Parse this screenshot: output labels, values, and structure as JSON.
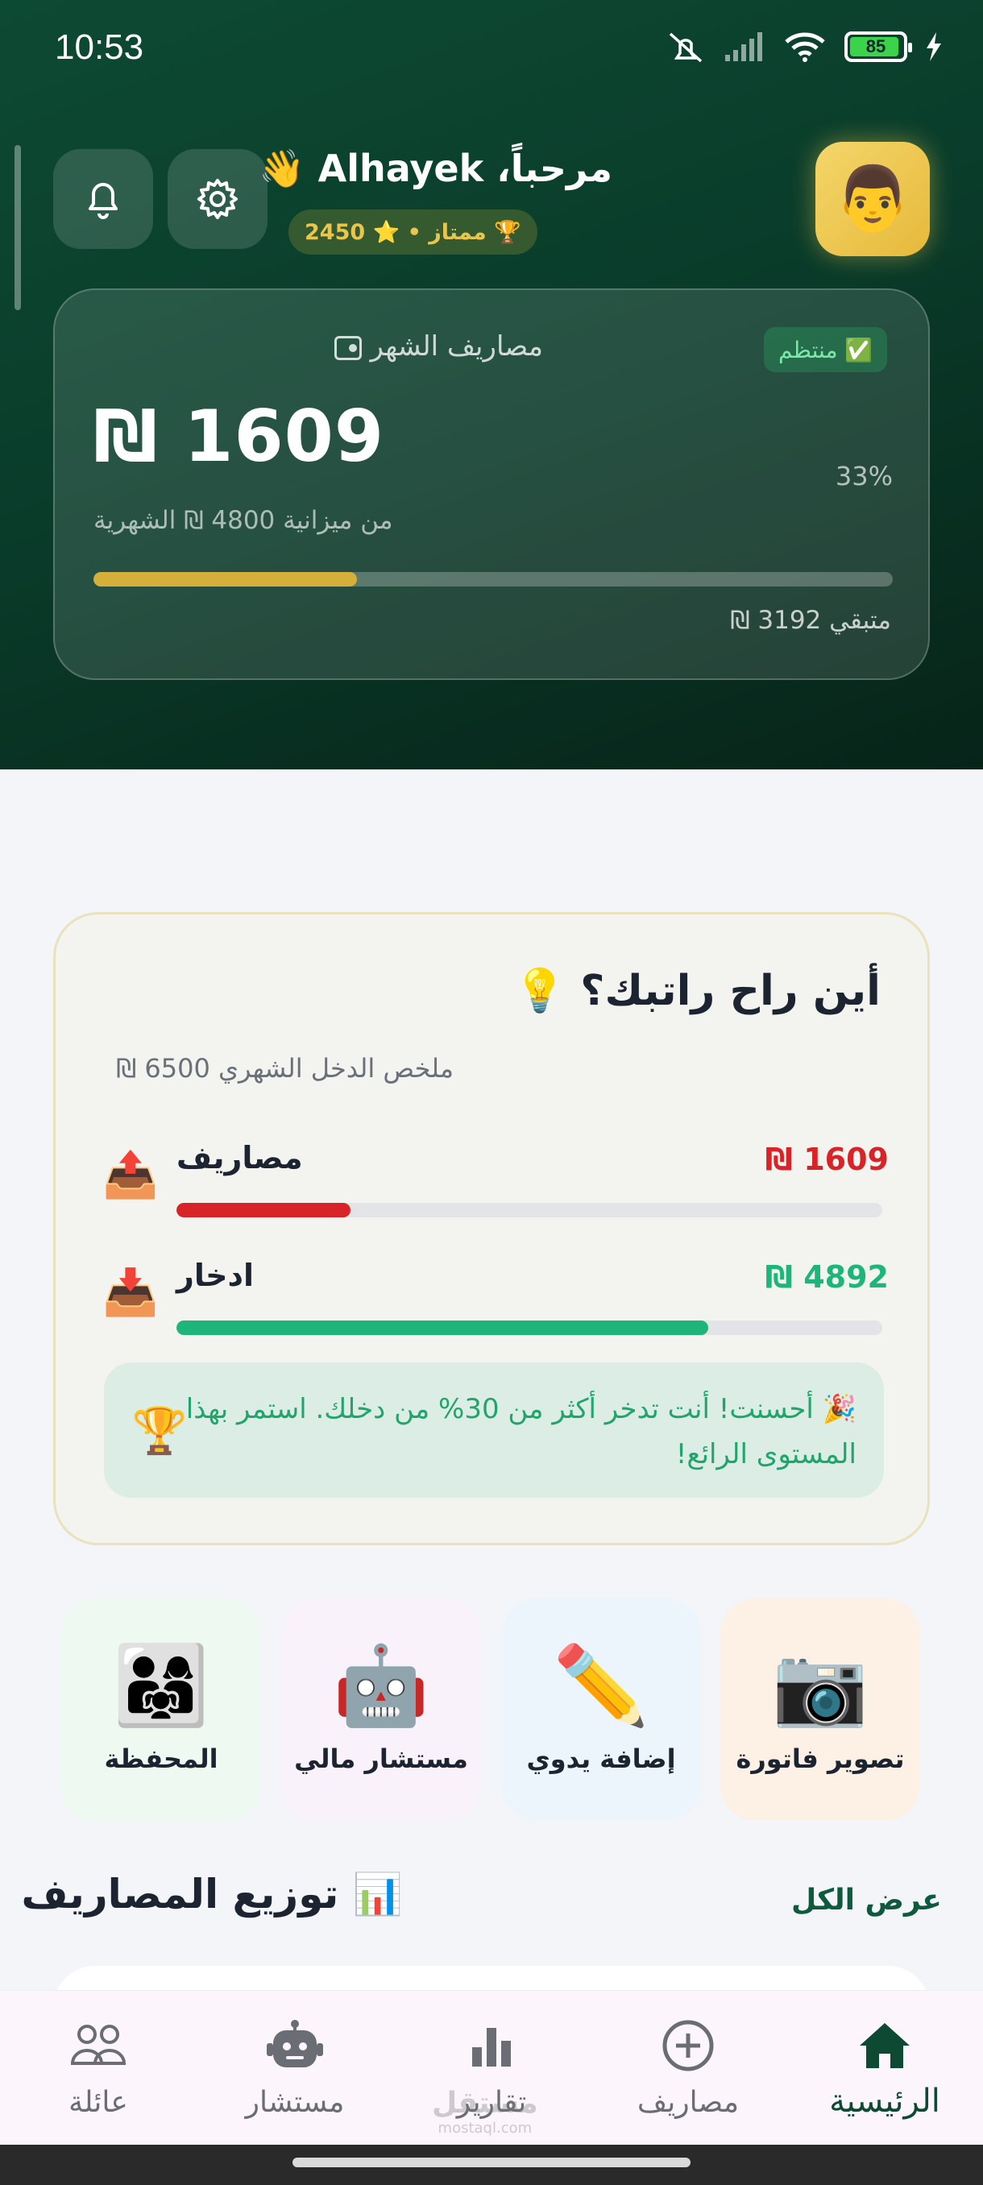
{
  "status": {
    "time": "10:53",
    "battery": "85"
  },
  "header": {
    "greeting": "مرحباً، Alhayek 👋",
    "rank": "🏆 ممتاز • ⭐ 2450",
    "avatar_emoji": "👨"
  },
  "month_card": {
    "title": "مصاريف الشهر",
    "badge": "✅ منتظم",
    "amount": "₪ 1609",
    "budget_text": "من ميزانية 4800 ₪ الشهرية",
    "percent": "33%",
    "progress_fraction": 0.33,
    "remaining": "متبقي 3192 ₪"
  },
  "salary_card": {
    "title": "أين راح راتبك؟ 💡",
    "subtitle": "ملخص الدخل الشهري 6500 ₪",
    "rows": [
      {
        "label": "مصاريف",
        "amount": "₪ 1609",
        "icon": "📤",
        "fraction": 0.247,
        "color": "#d82428"
      },
      {
        "label": "ادخار",
        "amount": "₪ 4892",
        "icon": "📥",
        "fraction": 0.753,
        "color": "#1db57a"
      }
    ],
    "tip": "🎉 أحسنت! أنت تدخر أكثر من 30% من دخلك. استمر بهذا المستوى الرائع!",
    "tip_icon": "🏆"
  },
  "actions": [
    {
      "label": "المحفظة",
      "emoji": "👨‍👩‍👧",
      "bg": "#eefaf1"
    },
    {
      "label": "مستشار مالي",
      "emoji": "🤖",
      "bg": "#faf2fa"
    },
    {
      "label": "إضافة يدوي",
      "emoji": "✏️",
      "bg": "#edf5fc"
    },
    {
      "label": "تصوير فاتورة",
      "emoji": "📷",
      "bg": "#fdf0e4"
    }
  ],
  "distribution": {
    "title": "📊 توزيع المصاريف",
    "view_all": "عرض الكل"
  },
  "nav": [
    {
      "label": "عائلة",
      "icon": "family-icon"
    },
    {
      "label": "مستشار",
      "icon": "robot-icon"
    },
    {
      "label": "تقارير",
      "icon": "bar-chart-icon"
    },
    {
      "label": "مصاريف",
      "icon": "add-circle-icon"
    },
    {
      "label": "الرئيسية",
      "icon": "home-icon"
    }
  ],
  "watermark": {
    "text": "مستقل",
    "sub": "mostaql.com"
  },
  "colors": {
    "accent": "#0e4a33",
    "gold": "#d4b03a",
    "expense": "#d82428",
    "saving": "#1db57a"
  }
}
